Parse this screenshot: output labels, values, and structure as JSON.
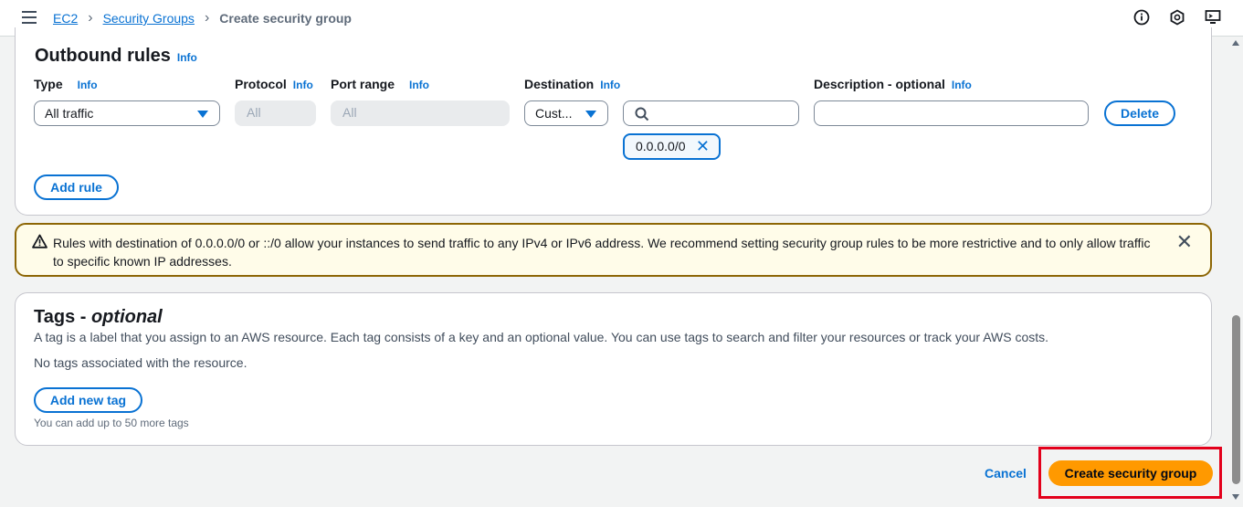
{
  "breadcrumb": {
    "items": [
      "EC2",
      "Security Groups"
    ],
    "current": "Create security group"
  },
  "outbound": {
    "title": "Outbound rules",
    "info": "Info",
    "columns": {
      "type": "Type",
      "protocol": "Protocol",
      "port_range": "Port range",
      "destination": "Destination",
      "description": "Description - optional"
    },
    "rule": {
      "type_value": "All traffic",
      "protocol_value": "All",
      "port_range_value": "All",
      "destination_value": "Cust...",
      "search_value": "",
      "description_value": "",
      "token": "0.0.0.0/0"
    },
    "delete_label": "Delete",
    "add_rule_label": "Add rule"
  },
  "alert": {
    "text": "Rules with destination of 0.0.0.0/0 or ::/0 allow your instances to send traffic to any IPv4 or IPv6 address. We recommend setting security group rules to be more restrictive and to only allow traffic to specific known IP addresses."
  },
  "tags": {
    "title": "Tags - ",
    "title_em": "optional",
    "description": "A tag is a label that you assign to an AWS resource. Each tag consists of a key and an optional value. You can use tags to search and filter your resources or track your AWS costs.",
    "empty": "No tags associated with the resource.",
    "add_label": "Add new tag",
    "hint": "You can add up to 50 more tags"
  },
  "footer": {
    "cancel_label": "Cancel",
    "create_label": "Create security group"
  },
  "colors": {
    "link": "#0972d3",
    "primary": "#ff9900",
    "warning_border": "#8d6605",
    "highlight": "#e3001b"
  }
}
